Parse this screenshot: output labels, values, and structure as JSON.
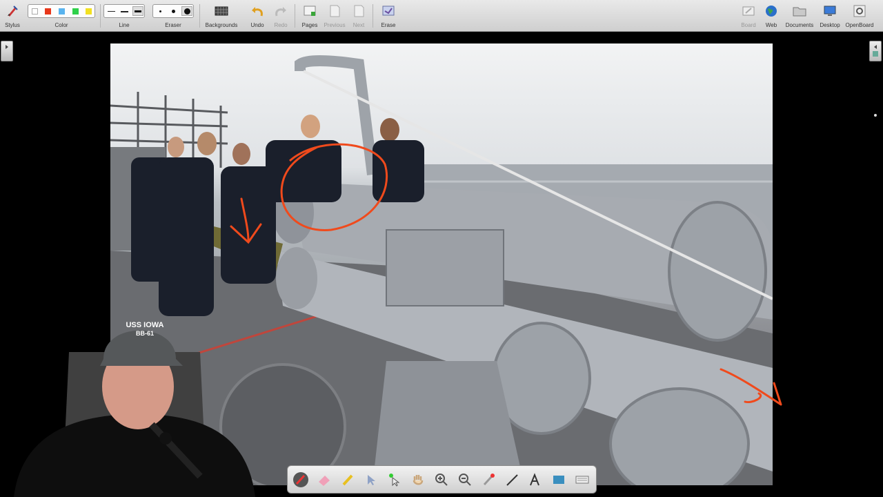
{
  "toolbar": {
    "stylus": "Stylus",
    "color": "Color",
    "line": "Line",
    "eraser": "Eraser",
    "backgrounds": "Backgrounds",
    "undo": "Undo",
    "redo": "Redo",
    "pages": "Pages",
    "previous": "Previous",
    "next": "Next",
    "erase": "Erase",
    "board": "Board",
    "web": "Web",
    "documents": "Documents",
    "desktop": "Desktop",
    "openboard": "OpenBoard"
  },
  "colors": {
    "swatches": [
      "#ffffff",
      "#e8371a",
      "#5ab4ef",
      "#2fd04a",
      "#f2e020"
    ],
    "annotation": "#f04a1c",
    "toolbar_bg": "#dcdcdc"
  },
  "photo": {
    "cap_text_line1": "USS IOWA",
    "cap_text_line2": "BB-61"
  },
  "floating_toolbar": {
    "tools": [
      "pen-icon",
      "eraser-icon",
      "marker-icon",
      "selector-icon",
      "interact-icon",
      "hand-icon",
      "zoom-in-icon",
      "zoom-out-icon",
      "laser-pointer-icon",
      "line-icon",
      "text-icon",
      "capture-icon",
      "keyboard-icon"
    ]
  }
}
